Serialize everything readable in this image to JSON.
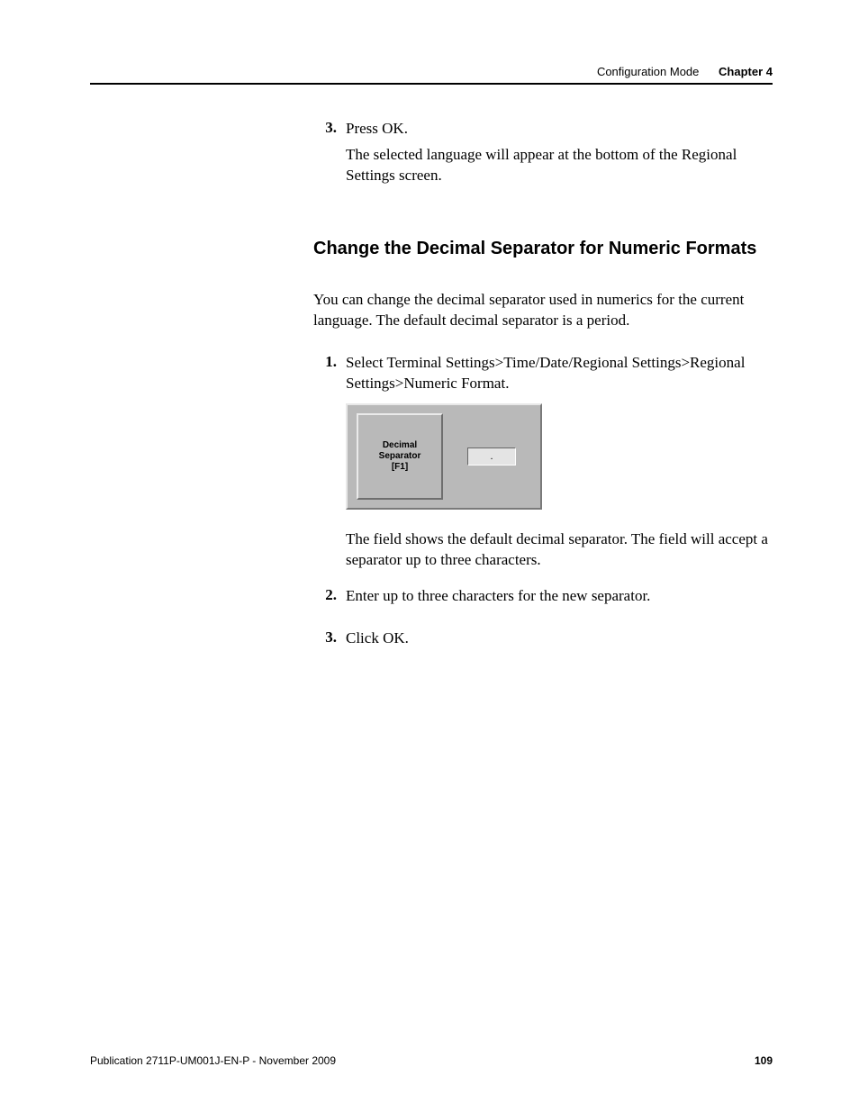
{
  "header": {
    "section": "Configuration Mode",
    "chapter": "Chapter 4"
  },
  "step_a": {
    "num": "3.",
    "text": "Press OK.",
    "followup": "The selected language will appear at the bottom of the Regional Settings screen."
  },
  "heading": "Change the Decimal Separator for Numeric Formats",
  "intro": "You can change the decimal separator used in numerics for the current language. The default decimal separator is a period.",
  "step1": {
    "num": "1.",
    "text": "Select Terminal Settings>Time/Date/Regional Settings>Regional Settings>Numeric Format."
  },
  "ui": {
    "button_l1": "Decimal",
    "button_l2": "Separator",
    "button_l3": "[F1]",
    "field_value": "."
  },
  "step1_follow": "The field shows the default decimal separator. The field will accept a separator up to three characters.",
  "step2": {
    "num": "2.",
    "text": "Enter up to three characters for the new separator."
  },
  "step3": {
    "num": "3.",
    "text": "Click OK."
  },
  "footer": {
    "pub": "Publication 2711P-UM001J-EN-P - November 2009",
    "page": "109"
  }
}
